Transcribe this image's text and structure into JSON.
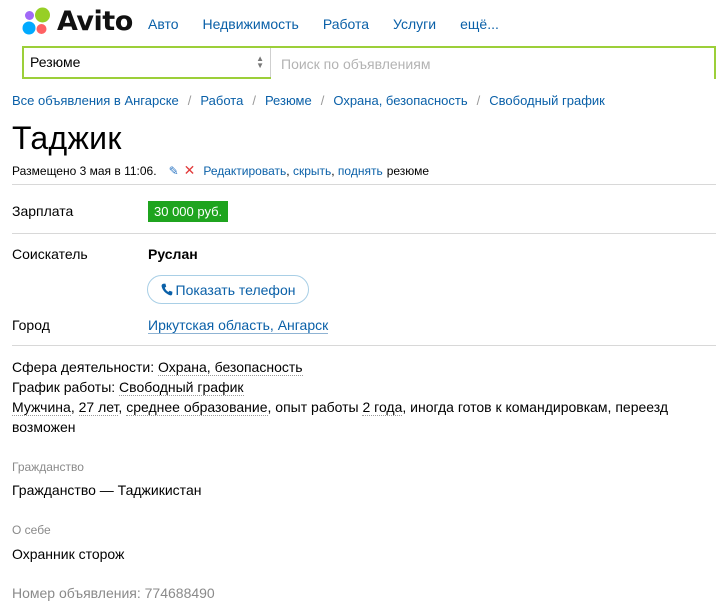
{
  "header": {
    "logo_text": "Avito",
    "nav": [
      "Авто",
      "Недвижимость",
      "Работа",
      "Услуги",
      "ещё..."
    ]
  },
  "search": {
    "category": "Резюме",
    "placeholder": "Поиск по объявлениям"
  },
  "breadcrumbs": [
    "Все объявления в Ангарске",
    "Работа",
    "Резюме",
    "Охрана, безопасность",
    "Свободный график"
  ],
  "ad": {
    "title": "Таджик",
    "posted": "Размещено 3 мая в 11:06.",
    "actions": {
      "edit": "Редактировать",
      "hide": "скрыть",
      "raise": "поднять",
      "suffix": "резюме"
    },
    "salary_label": "Зарплата",
    "salary_value": "30 000 руб.",
    "seeker_label": "Соискатель",
    "seeker_name": "Руслан",
    "phone_button": "Показать телефон",
    "city_label": "Город",
    "city_value": "Иркутская область, Ангарск",
    "sphere_label": "Сфера деятельности:",
    "sphere_value": "Охрана, безопасность",
    "schedule_label": "График работы:",
    "schedule_value": "Свободный график",
    "gender": "Мужчина",
    "age": "27 лет",
    "education": "среднее образование",
    "experience_prefix": "опыт работы",
    "experience_value": "2 года",
    "trips": "иногда готов к командировкам, переезд возможен",
    "citizenship_heading": "Гражданство",
    "citizenship_text": "Гражданство — Таджикистан",
    "about_heading": "О себе",
    "about_text": "Охранник сторож",
    "ad_number": "Номер объявления: 774688490"
  },
  "colors": {
    "brand_green": "#9ccf39",
    "link_blue": "#0a60a8",
    "salary_green": "#1fa41f"
  }
}
